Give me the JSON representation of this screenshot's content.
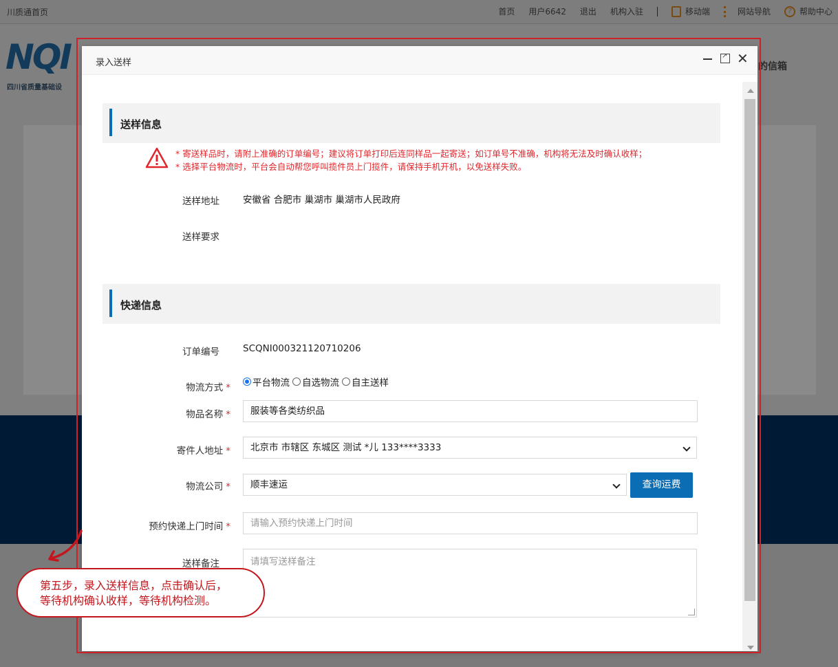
{
  "topbar": {
    "home": "川质通首页",
    "nav": {
      "index": "首页",
      "user": "用户6642",
      "logout": "退出",
      "org_join": "机构入驻",
      "mobile": "移动端",
      "site_nav": "网站导航",
      "help": "帮助中心"
    }
  },
  "header": {
    "logo_text": "NQI",
    "logo_sub": "四川省质量基础设",
    "mailbox": "的信箱"
  },
  "dialog": {
    "title": "录入送样",
    "sample_section": {
      "title": "送样信息",
      "notices": [
        "* 寄送样品时，请附上准确的订单编号；建议将订单打印后连同样品一起寄送；如订单号不准确，机构将无法及时确认收样；",
        "* 选择平台物流时，平台会自动帮您呼叫揽件员上门揽件，请保持手机开机，以免送样失败。"
      ],
      "address_label": "送样地址",
      "address_value": "安徽省 合肥市 巢湖市 巢湖市人民政府",
      "requirement_label": "送样要求",
      "requirement_value": ""
    },
    "express_section": {
      "title": "快递信息",
      "order_label": "订单编号",
      "order_value": "SCQNI000321120710206",
      "logistics_label": "物流方式",
      "logistics_options": [
        "平台物流",
        "自选物流",
        "自主送样"
      ],
      "logistics_selected": "平台物流",
      "item_label": "物品名称",
      "item_value": "服装等各类纺织品",
      "sender_label": "寄件人地址",
      "sender_value": "北京市 市辖区 东城区 测试  *儿 133****3333",
      "company_label": "物流公司",
      "company_value": "顺丰速运",
      "query_button": "查询运费",
      "pickup_label": "预约快递上门时间",
      "pickup_placeholder": "请输入预约快递上门时间",
      "remark_label": "送样备注",
      "remark_placeholder": "请填写送样备注",
      "required_mark": "*"
    }
  },
  "callout": {
    "line1": "第五步，录入送样信息，点击确认后，",
    "line2": "等待机构确认收样，等待机构检测。"
  },
  "colors": {
    "accent": "#0b6db4",
    "required": "#e0262b",
    "callout": "#c4161c",
    "band": "#001a35"
  }
}
